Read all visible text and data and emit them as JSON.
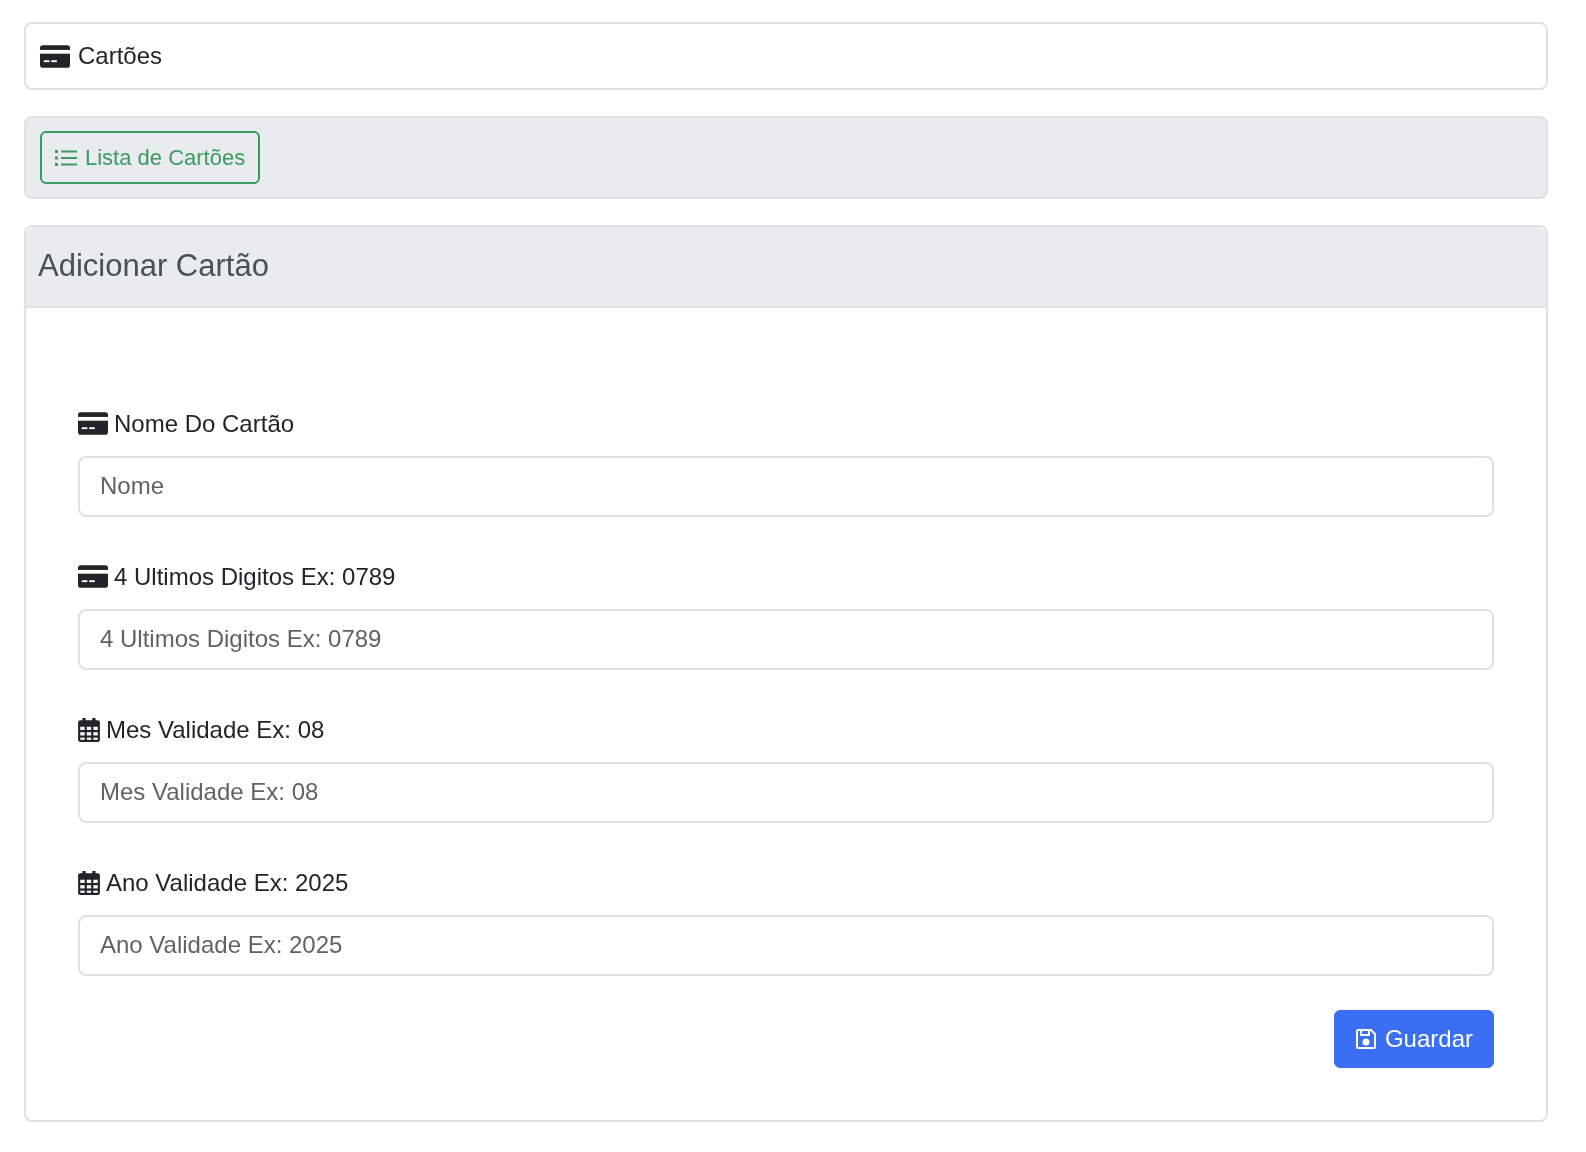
{
  "header": {
    "title": "Cartões"
  },
  "toolbar": {
    "button": "Lista de Cartões"
  },
  "form": {
    "title": "Adicionar Cartão",
    "fields": [
      {
        "kind": "card",
        "label": "Nome Do Cartão",
        "placeholder": "Nome"
      },
      {
        "kind": "card",
        "label": "4 Ultimos Digitos Ex: 0789",
        "placeholder": "4 Ultimos Digitos Ex: 0789"
      },
      {
        "kind": "calendar",
        "label": "Mes Validade Ex: 08",
        "placeholder": "Mes Validade Ex: 08"
      },
      {
        "kind": "calendar",
        "label": "Ano Validade Ex: 2025",
        "placeholder": "Ano Validade Ex: 2025"
      }
    ],
    "submit": "Guardar"
  }
}
